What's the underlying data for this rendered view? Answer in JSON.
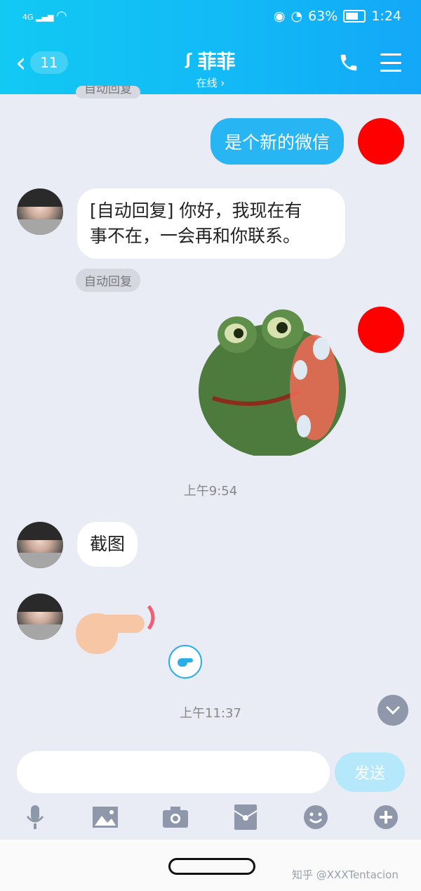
{
  "status_bar": {
    "network": "4G",
    "battery_percent": "63%",
    "time": "1:24"
  },
  "header": {
    "back_count": "11",
    "contact_name": "菲菲",
    "contact_status": "在线 ›"
  },
  "messages": [
    {
      "direction": "out",
      "text": "是个新的微信"
    },
    {
      "direction": "in",
      "text": "[自动回复] 你好，我现在有事不在，一会再和你联系。",
      "tag": "自动回复"
    },
    {
      "direction": "out",
      "type": "sticker",
      "sticker": "frog-sticker"
    },
    {
      "type": "time",
      "text": "上午9:54"
    },
    {
      "direction": "in",
      "text": "截图"
    },
    {
      "direction": "in",
      "type": "sticker",
      "sticker": "pointing-finger"
    },
    {
      "type": "time",
      "text": "上午11:37"
    }
  ],
  "auto_reply_tag": "自动回复",
  "time_1": "上午9:54",
  "time_2": "上午11:37",
  "msg_out_1": "是个新的微信",
  "msg_in_1_line1": "[自动回复] 你好，我现在有",
  "msg_in_1_line2": "事不在，一会再和你联系。",
  "msg_in_2": "截图",
  "input": {
    "placeholder": "",
    "send_label": "发送"
  },
  "toolbar": [
    "mic-icon",
    "image-icon",
    "camera-icon",
    "red-packet-icon",
    "emoji-icon",
    "plus-icon"
  ],
  "watermark": "知乎 @XXXTentacion",
  "colors": {
    "header": "#12b8f6",
    "bubble_out": "#28b5f4",
    "background": "#e9ecf5"
  }
}
